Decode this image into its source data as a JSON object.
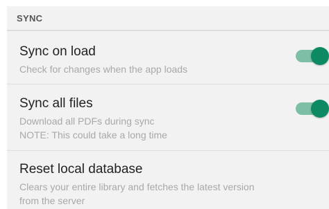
{
  "section": {
    "title": "SYNC"
  },
  "preferences": [
    {
      "title": "Sync on load",
      "summary_lines": [
        "Check for changes when the app loads"
      ],
      "toggle": true
    },
    {
      "title": "Sync all files",
      "summary_lines": [
        "Download all PDFs during sync",
        "NOTE: This could take a long time"
      ],
      "toggle": true
    },
    {
      "title": "Reset local database",
      "summary_lines": [
        "Clears your entire library and fetches the latest version",
        "from the server"
      ]
    }
  ],
  "colors": {
    "accent": "#0d8a63",
    "track_on": "#7dbfa5"
  }
}
